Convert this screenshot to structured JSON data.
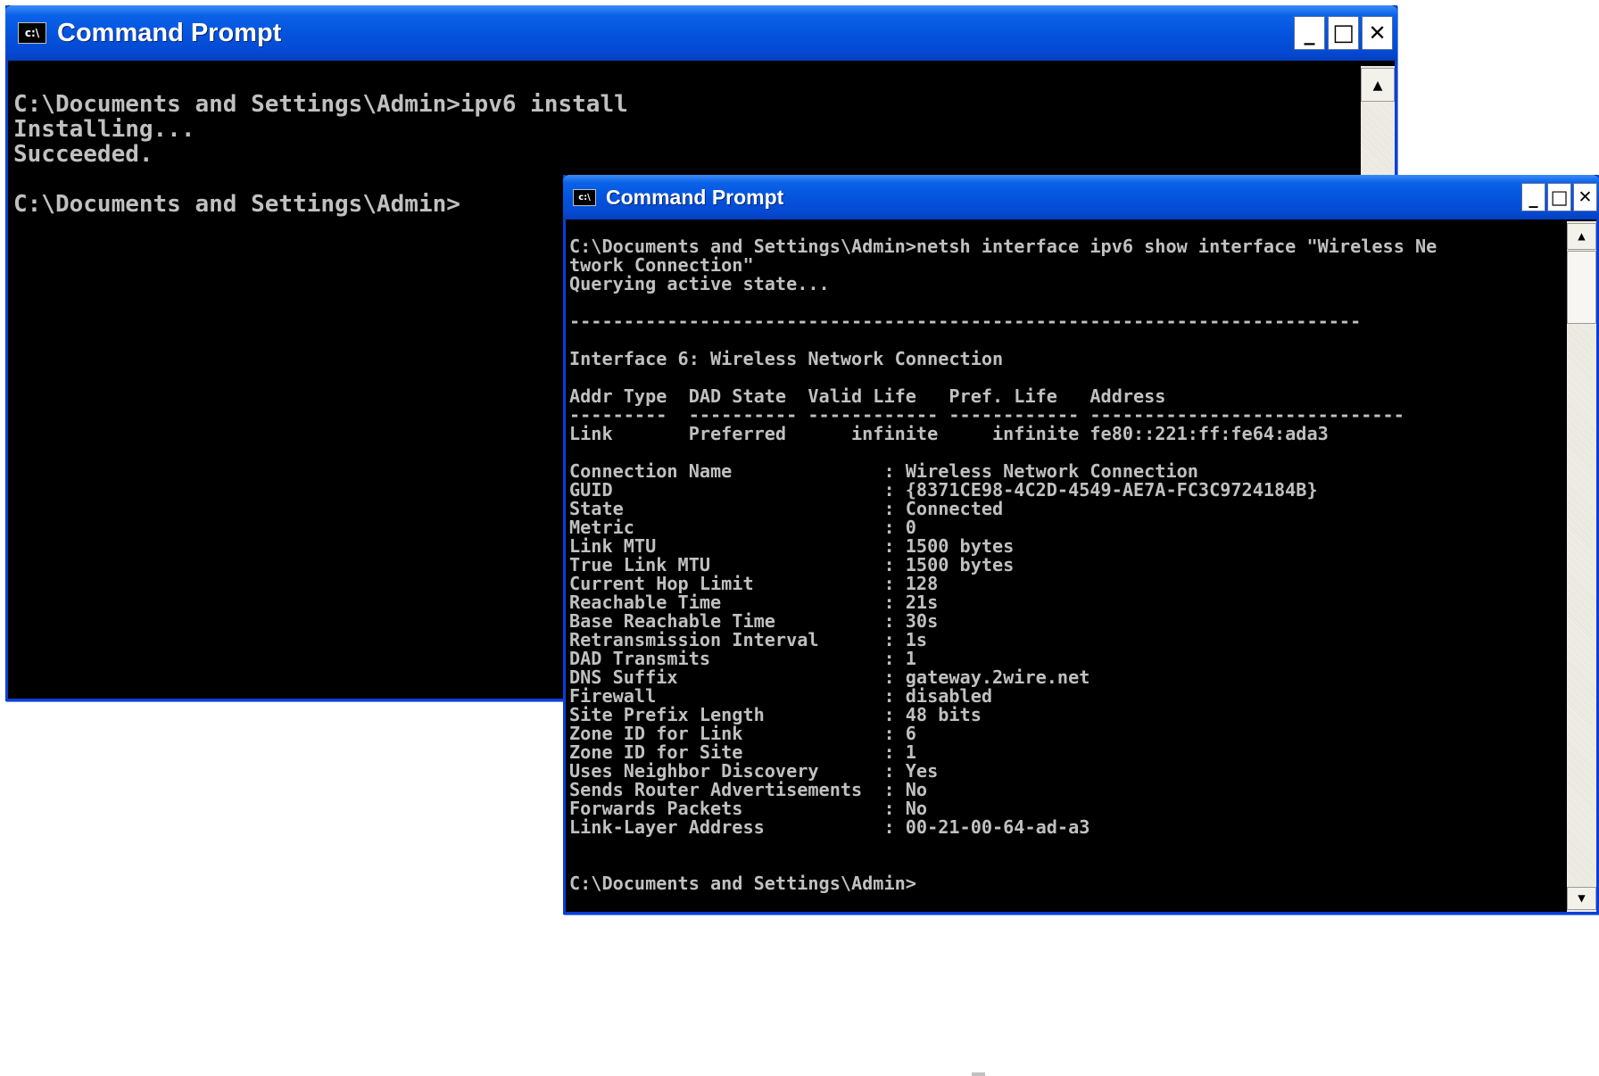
{
  "window1": {
    "title": "Command Prompt",
    "icon_text": "c:\\",
    "controls": {
      "minimize": "_",
      "maximize": "□",
      "close": "✕"
    },
    "console_text": "C:\\Documents and Settings\\Admin>ipv6 install\nInstalling...\nSucceeded.\n\nC:\\Documents and Settings\\Admin>",
    "scroll_up": "▲"
  },
  "window2": {
    "title": "Command Prompt",
    "icon_text": "c:\\",
    "controls": {
      "minimize": "_",
      "maximize": "□",
      "close": "✕"
    },
    "console_text": "C:\\Documents and Settings\\Admin>netsh interface ipv6 show interface \"Wireless Ne\ntwork Connection\"\nQuerying active state...\n\n-------------------------------------------------------------------------\n\nInterface 6: Wireless Network Connection\n\nAddr Type  DAD State  Valid Life   Pref. Life   Address\n---------  ---------- ------------ ------------ -----------------------------\nLink       Preferred      infinite     infinite fe80::221:ff:fe64:ada3\n\nConnection Name              : Wireless Network Connection\nGUID                         : {8371CE98-4C2D-4549-AE7A-FC3C9724184B}\nState                        : Connected\nMetric                       : 0\nLink MTU                     : 1500 bytes\nTrue Link MTU                : 1500 bytes\nCurrent Hop Limit            : 128\nReachable Time               : 21s\nBase Reachable Time          : 30s\nRetransmission Interval      : 1s\nDAD Transmits                : 1\nDNS Suffix                   : gateway.2wire.net\nFirewall                     : disabled\nSite Prefix Length           : 48 bits\nZone ID for Link             : 6\nZone ID for Site             : 1\nUses Neighbor Discovery      : Yes\nSends Router Advertisements  : No\nForwards Packets             : No\nLink-Layer Address           : 00-21-00-64-ad-a3\n\n\nC:\\Documents and Settings\\Admin>",
    "scroll_up": "▲",
    "scroll_down": "▼"
  },
  "colors": {
    "titlebar_blue": "#0454de",
    "console_bg": "#000000",
    "console_text": "#c0c0c0",
    "close_red": "#000000"
  }
}
